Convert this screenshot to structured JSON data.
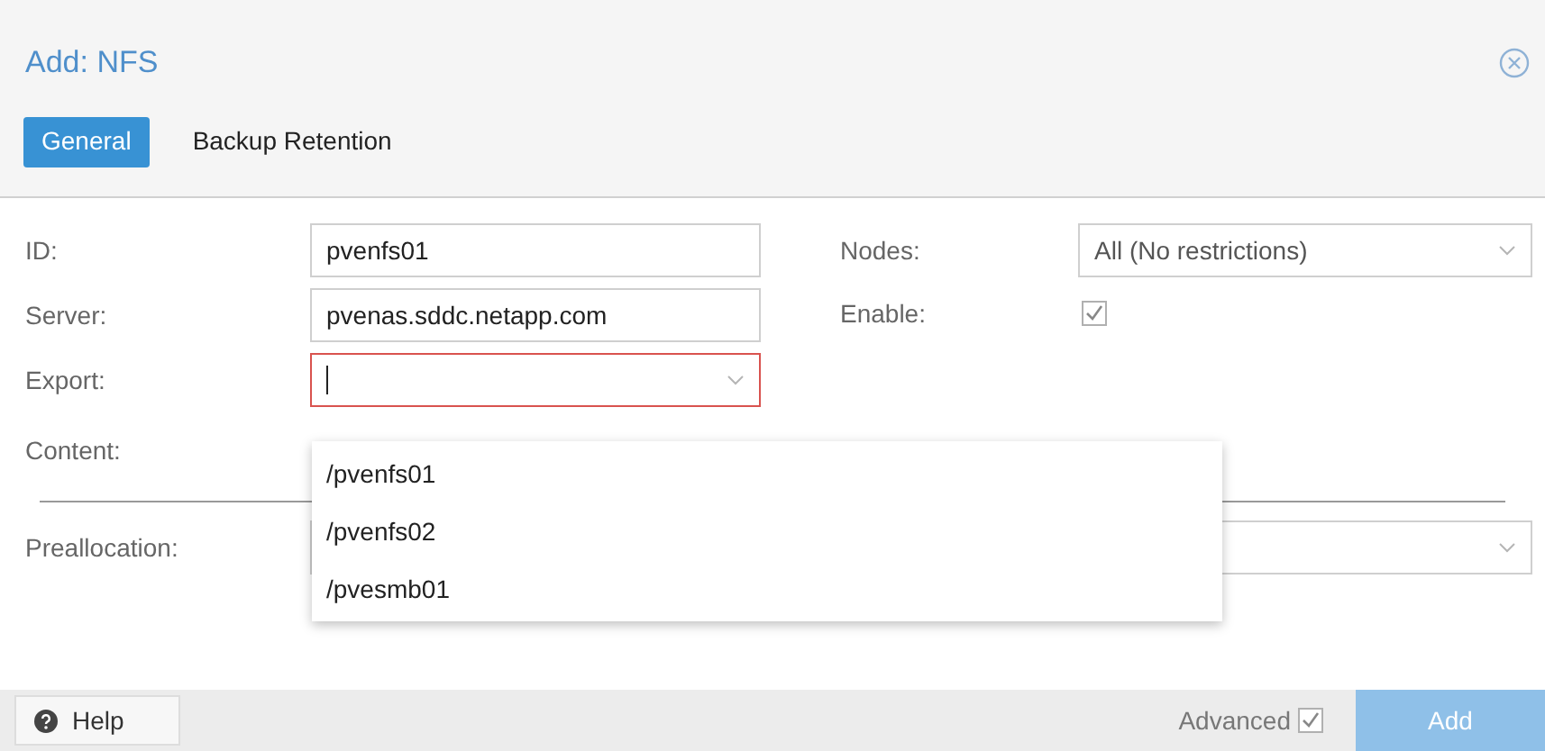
{
  "window": {
    "title": "Add: NFS"
  },
  "tabs": [
    {
      "label": "General",
      "selected": true
    },
    {
      "label": "Backup Retention",
      "selected": false
    }
  ],
  "left_fields": [
    {
      "label": "ID:",
      "kind": "text",
      "value": "pvenfs01"
    },
    {
      "label": "Server:",
      "kind": "text",
      "value": "pvenas.sddc.netapp.com"
    },
    {
      "label": "Export:",
      "kind": "combo",
      "invalid": true,
      "focused": true
    },
    {
      "label": "Content:",
      "kind": "hidden"
    }
  ],
  "right_fields": [
    {
      "label": "Nodes:",
      "kind": "combo",
      "value": "All (No restrictions)"
    },
    {
      "label": "Enable:",
      "kind": "checkbox",
      "checked": true
    }
  ],
  "preallocation": {
    "label": "Preallocation:"
  },
  "dropdown": {
    "items": [
      {
        "label": "/pvenfs01"
      },
      {
        "label": "/pvenfs02"
      },
      {
        "label": "/pvesmb01"
      }
    ]
  },
  "footer": {
    "help": "Help",
    "advanced": {
      "label": "Advanced",
      "checked": true
    },
    "add": {
      "label": "Add",
      "disabled": true
    }
  }
}
